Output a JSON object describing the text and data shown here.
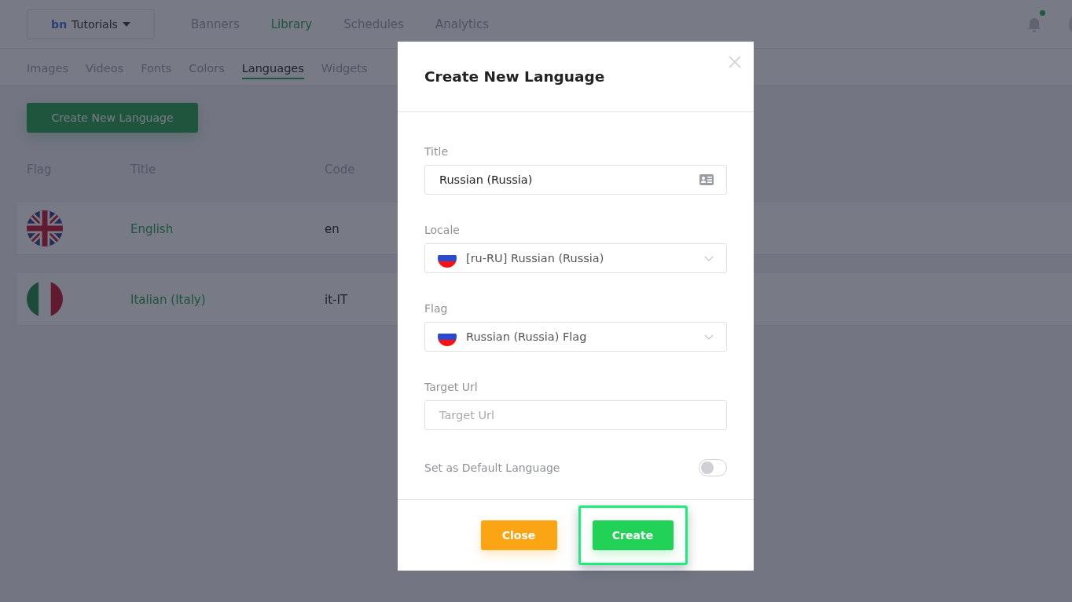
{
  "workspace": {
    "logo": "bn",
    "name": "Tutorials"
  },
  "nav": [
    {
      "label": "Banners",
      "selected": false
    },
    {
      "label": "Library",
      "selected": true
    },
    {
      "label": "Schedules",
      "selected": false
    },
    {
      "label": "Analytics",
      "selected": false
    }
  ],
  "notifications": {
    "unread": true
  },
  "subnav": [
    {
      "label": "Images",
      "selected": false
    },
    {
      "label": "Videos",
      "selected": false
    },
    {
      "label": "Fonts",
      "selected": false
    },
    {
      "label": "Colors",
      "selected": false
    },
    {
      "label": "Languages",
      "selected": true
    },
    {
      "label": "Widgets",
      "selected": false
    }
  ],
  "create_button": "Create New Language",
  "table": {
    "columns": [
      "Flag",
      "Title",
      "Code"
    ],
    "rows": [
      {
        "flag": {
          "kind": "uk"
        },
        "title": "English",
        "code": "en"
      },
      {
        "flag": {
          "kind": "it"
        },
        "title": "Italian (Italy)",
        "code": "it-IT"
      }
    ]
  },
  "modal": {
    "title": "Create New Language",
    "fields": [
      {
        "kind": "text",
        "label": "Title",
        "value": "Russian (Russia)",
        "card_icon": true
      },
      {
        "kind": "select",
        "label": "Locale",
        "value": "[ru-RU] Russian (Russia)",
        "flag": {
          "kind": "ru"
        }
      },
      {
        "kind": "select",
        "label": "Flag",
        "value": "Russian (Russia) Flag",
        "flag": {
          "kind": "ru"
        }
      },
      {
        "kind": "text",
        "label": "Target Url",
        "placeholder": "Target Url",
        "card_icon": false
      }
    ],
    "default_toggle": {
      "label": "Set as Default Language",
      "on": false
    },
    "buttons": [
      {
        "kind": "close",
        "label": "Close",
        "highlighted": false
      },
      {
        "kind": "primary",
        "label": "Create",
        "highlighted": true
      }
    ]
  }
}
